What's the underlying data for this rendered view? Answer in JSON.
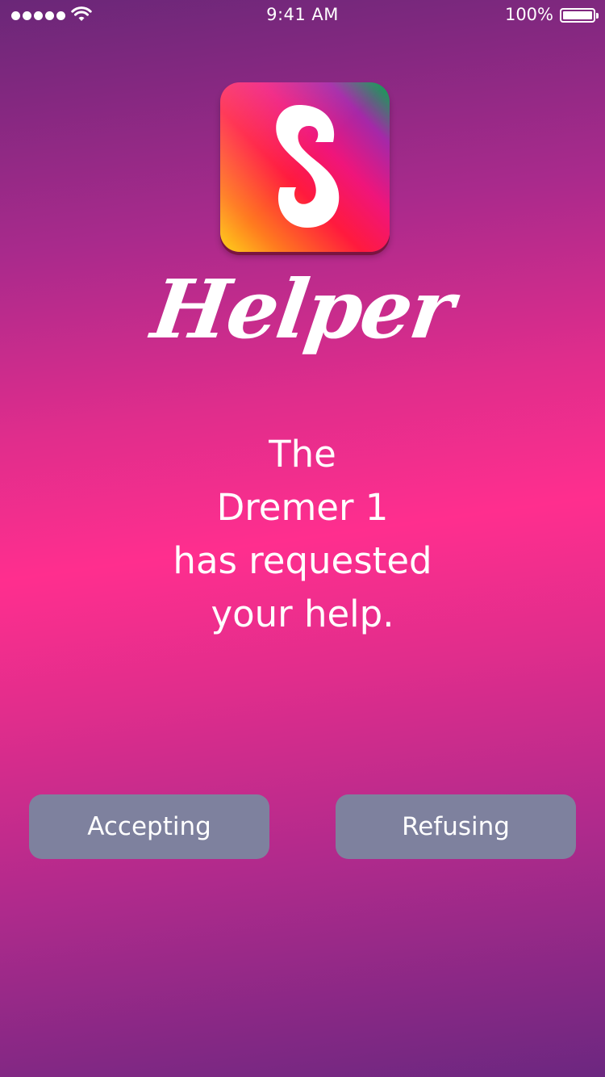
{
  "status_bar": {
    "time": "9:41 AM",
    "battery_percent": "100%",
    "signal_bars": 5,
    "wifi_icon": "wifi-icon",
    "battery_icon": "battery-full-icon"
  },
  "app": {
    "icon_letter": "S",
    "name": "Helper",
    "icon_colors": [
      "#ffd21a",
      "#ff1a3e",
      "#a528a8",
      "#00b04a"
    ]
  },
  "message": {
    "lines": [
      "The",
      "Dremer 1",
      "has requested",
      "your help."
    ]
  },
  "actions": {
    "accept_label": "Accepting",
    "refuse_label": "Refusing"
  },
  "colors": {
    "background_mid": "#ff2e8e",
    "background_edge": "#6a2778",
    "button": "#7e819e",
    "text": "#ffffff"
  }
}
